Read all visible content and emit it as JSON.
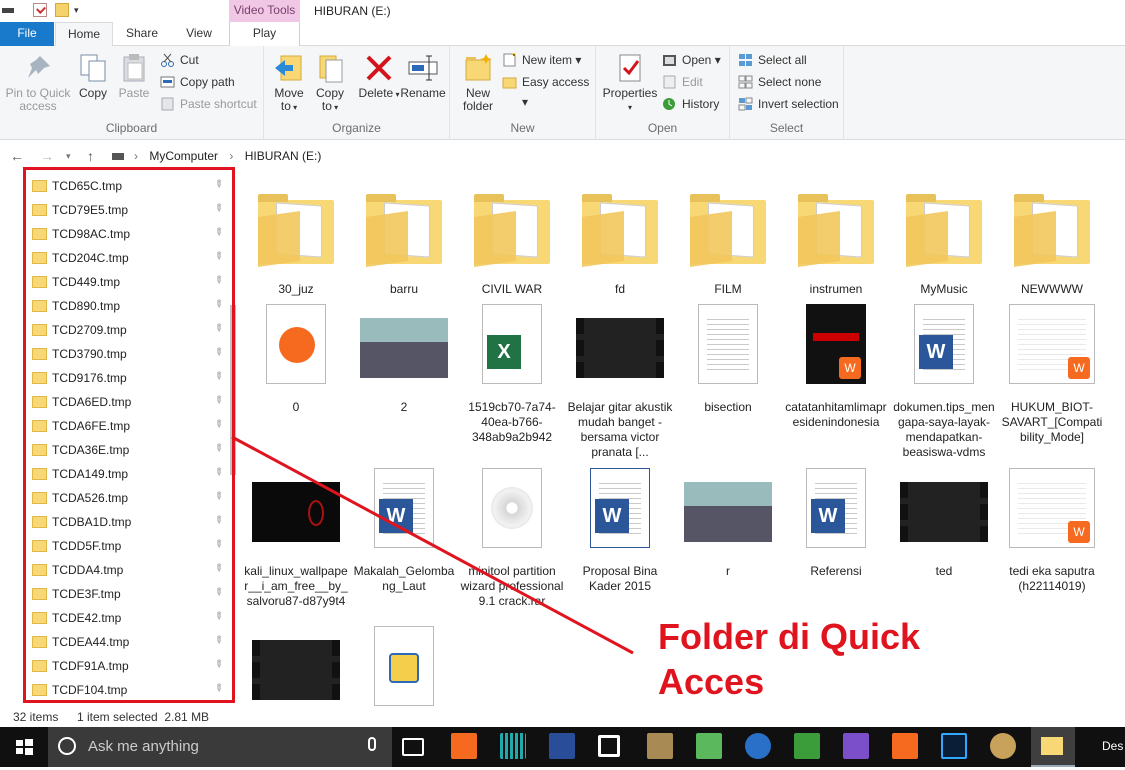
{
  "window": {
    "title": "HIBURAN (E:)",
    "context_tab": "Video Tools"
  },
  "tabs": [
    "File",
    "Home",
    "Share",
    "View",
    "Play"
  ],
  "ribbon": {
    "clipboard": {
      "label": "Clipboard",
      "pin": "Pin to Quick access",
      "copy": "Copy",
      "paste": "Paste",
      "cut": "Cut",
      "copy_path": "Copy path",
      "paste_shortcut": "Paste shortcut"
    },
    "organize": {
      "label": "Organize",
      "move_to": "Move to",
      "copy_to": "Copy to",
      "delete": "Delete",
      "rename": "Rename"
    },
    "new": {
      "label": "New",
      "new_folder": "New folder",
      "new_item": "New item",
      "easy_access": "Easy access"
    },
    "open": {
      "label": "Open",
      "properties": "Properties",
      "open": "Open",
      "edit": "Edit",
      "history": "History"
    },
    "select": {
      "label": "Select",
      "select_all": "Select all",
      "select_none": "Select none",
      "invert": "Invert selection"
    }
  },
  "address": {
    "crumbs": [
      "MyComputer",
      "HIBURAN (E:)"
    ]
  },
  "quick_access": [
    "TCD65C.tmp",
    "TCD79E5.tmp",
    "TCD98AC.tmp",
    "TCD204C.tmp",
    "TCD449.tmp",
    "TCD890.tmp",
    "TCD2709.tmp",
    "TCD3790.tmp",
    "TCD9176.tmp",
    "TCDA6ED.tmp",
    "TCDA6FE.tmp",
    "TCDA36E.tmp",
    "TCDA149.tmp",
    "TCDA526.tmp",
    "TCDBA1D.tmp",
    "TCDD5F.tmp",
    "TCDDA4.tmp",
    "TCDE3F.tmp",
    "TCDE42.tmp",
    "TCDEA44.tmp",
    "TCDF91A.tmp",
    "TCDF104.tmp"
  ],
  "files": [
    {
      "name": "30_juz",
      "kind": "folder"
    },
    {
      "name": "barru",
      "kind": "folder"
    },
    {
      "name": "CIVIL WAR",
      "kind": "folder"
    },
    {
      "name": "fd",
      "kind": "folder"
    },
    {
      "name": "FILM",
      "kind": "folder"
    },
    {
      "name": "instrumen",
      "kind": "folder"
    },
    {
      "name": "MyMusic",
      "kind": "folder"
    },
    {
      "name": "NEWWWW",
      "kind": "folder"
    },
    {
      "name": "0",
      "kind": "uc"
    },
    {
      "name": "2",
      "kind": "photo"
    },
    {
      "name": "1519cb70-7a74-40ea-b766-348ab9a2b942",
      "kind": "excel"
    },
    {
      "name": "Belajar gitar akustik mudah banget - bersama victor pranata [...",
      "kind": "video"
    },
    {
      "name": "bisection",
      "kind": "text"
    },
    {
      "name": "catatanhitamlimapresidenindonesia",
      "kind": "book"
    },
    {
      "name": "dokumen.tips_mengapa-saya-layak-mendapatkan-beasiswa-vdms",
      "kind": "word"
    },
    {
      "name": "HUKUM_BIOT-SAVART_[Compatibility_Mode]",
      "kind": "wps"
    },
    {
      "name": "kali_linux_wallpaper__i_am_free__by_salvoru87-d87y9t4",
      "kind": "dark"
    },
    {
      "name": "Makalah_Gelombang_Laut",
      "kind": "word"
    },
    {
      "name": "minitool partition wizard professional 9.1 crack.rar",
      "kind": "disc"
    },
    {
      "name": "Proposal Bina Kader 2015",
      "kind": "word2"
    },
    {
      "name": "r",
      "kind": "photo"
    },
    {
      "name": "Referensi",
      "kind": "word"
    },
    {
      "name": "ted",
      "kind": "video"
    },
    {
      "name": "tedi eka saputra (h22114019)",
      "kind": "wps"
    },
    {
      "name": "",
      "kind": "video"
    },
    {
      "name": "",
      "kind": "shortcut"
    }
  ],
  "annotation": {
    "line1": "Folder di Quick",
    "line2": "Acces"
  },
  "status": {
    "items": "32 items",
    "selected": "1 item selected  2.81 MB"
  },
  "taskbar": {
    "search": "Ask me anything",
    "desktop": "Des"
  },
  "colors": {
    "accent": "#1979ca",
    "annotation": "#e0141e",
    "video_tools": "#f0c8e6"
  }
}
